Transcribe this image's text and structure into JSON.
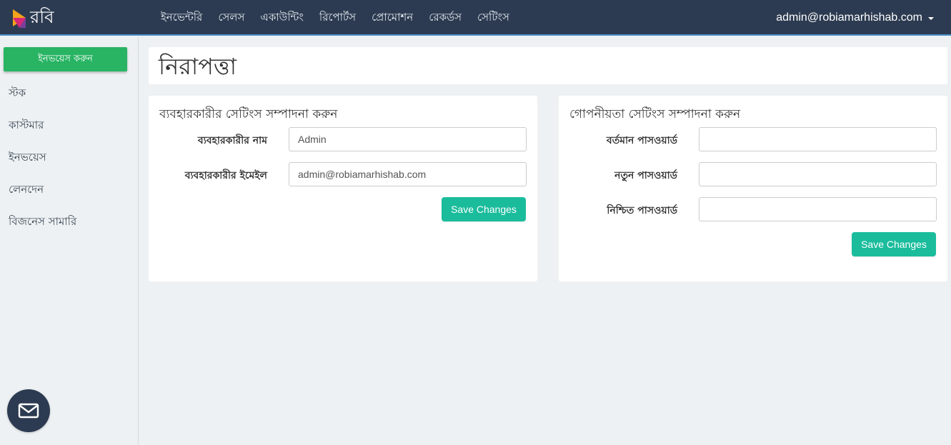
{
  "brand": {
    "logo_text": "রবি"
  },
  "nav": {
    "items": [
      "ইনভেন্টরি",
      "সেলস",
      "একাউন্টিং",
      "রিপোর্টস",
      "প্রোমোশন",
      "রেকর্ডস",
      "সেটিংস"
    ],
    "user_email": "admin@robiamarhishab.com"
  },
  "sidebar": {
    "invoice_button": "ইনভয়েস করুন",
    "items": [
      "স্টক",
      "কাস্টমার",
      "ইনভয়েস",
      "লেনদেন",
      "বিজনেস সামারি"
    ]
  },
  "page": {
    "title": "নিরাপত্তা"
  },
  "user_settings": {
    "title": "ব্যবহারকারীর সেটিংস সম্পাদনা করুন",
    "name_label": "ব্যবহারকারীর নাম",
    "name_value": "Admin",
    "email_label": "ব্যবহারকারীর ইমেইল",
    "email_value": "admin@robiamarhishab.com",
    "save_label": "Save Changes"
  },
  "privacy_settings": {
    "title": "গোপনীয়তা সেটিংস সম্পাদনা করুন",
    "current_label": "বর্তমান পাসওয়ার্ড",
    "current_value": "",
    "new_label": "নতুন পাসওয়ার্ড",
    "new_value": "",
    "confirm_label": "নিশ্চিত পাসওয়ার্ড",
    "confirm_value": "",
    "save_label": "Save Changes"
  },
  "icons": {
    "logo": "robi-logo-icon",
    "caret": "caret-down-icon",
    "mail": "mail-icon"
  },
  "colors": {
    "navbar": "#2c3b51",
    "invoice_button": "#28b463",
    "save_button": "#1abc9c"
  }
}
